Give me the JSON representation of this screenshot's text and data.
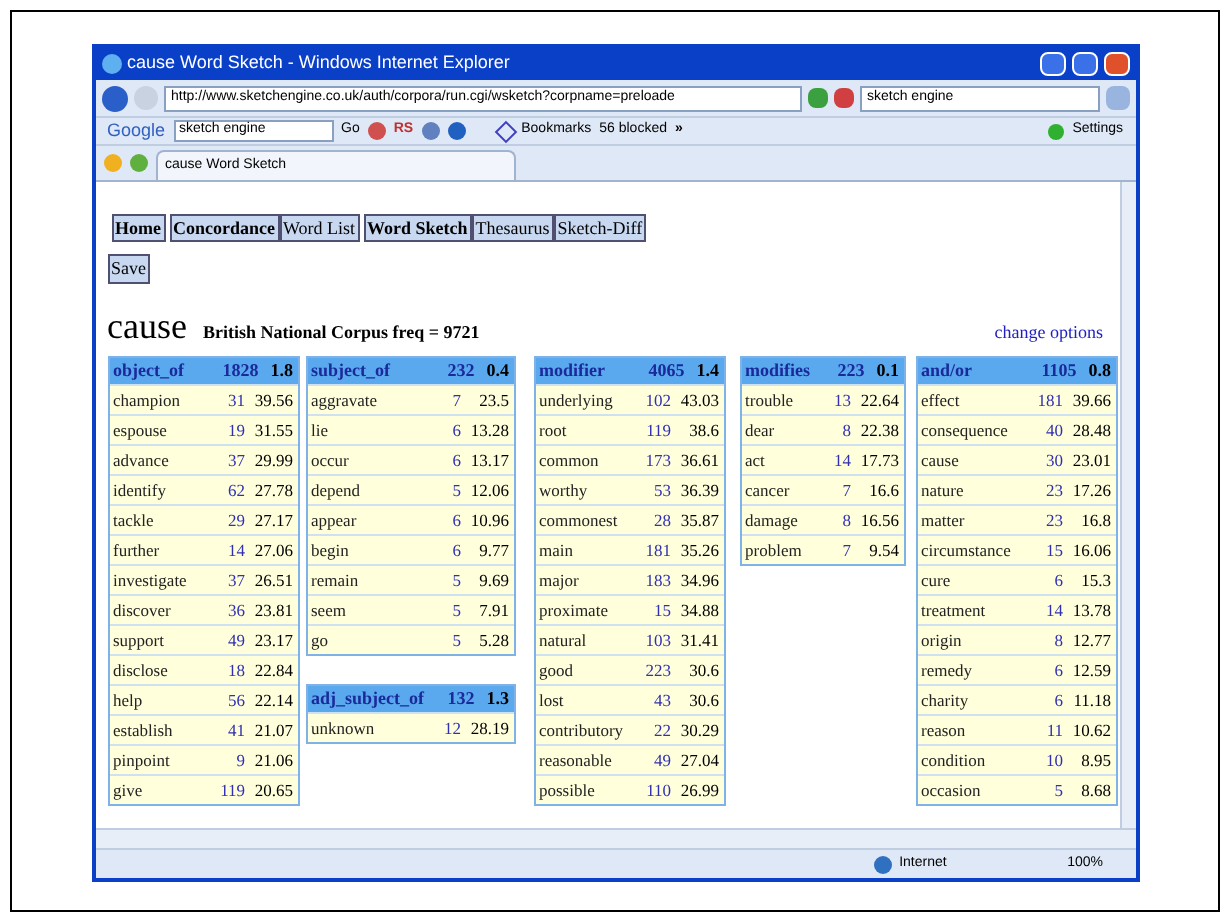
{
  "window": {
    "title": "cause Word Sketch - Windows Internet Explorer"
  },
  "address_bar": {
    "url": "http://www.sketchengine.co.uk/auth/corpora/run.cgi/wsketch?corpname=preloade",
    "search": "sketch engine"
  },
  "google_toolbar": {
    "logo": "Google",
    "search": "sketch engine",
    "go": "Go",
    "rs": "RS",
    "bookmarks": "Bookmarks",
    "blocked": "56 blocked",
    "more": "»",
    "settings": "Settings"
  },
  "tab": {
    "title": "cause Word Sketch"
  },
  "nav": [
    {
      "label": "Home",
      "bold": true
    },
    {
      "label": "Concordance",
      "bold": true
    },
    {
      "label": "Word List",
      "bold": false
    },
    {
      "label": "Word Sketch",
      "bold": true
    },
    {
      "label": "Thesaurus",
      "bold": false
    },
    {
      "label": "Sketch-Diff",
      "bold": false
    }
  ],
  "save": "Save",
  "headword": "cause",
  "corpus_info": "British National Corpus freq = 9721",
  "change_options": "change options",
  "columns": [
    [
      {
        "heading": "object_of",
        "count": "1828",
        "score": "1.8",
        "rows": [
          {
            "word": "champion",
            "freq": "31",
            "score": "39.56"
          },
          {
            "word": "espouse",
            "freq": "19",
            "score": "31.55"
          },
          {
            "word": "advance",
            "freq": "37",
            "score": "29.99"
          },
          {
            "word": "identify",
            "freq": "62",
            "score": "27.78"
          },
          {
            "word": "tackle",
            "freq": "29",
            "score": "27.17"
          },
          {
            "word": "further",
            "freq": "14",
            "score": "27.06"
          },
          {
            "word": "investigate",
            "freq": "37",
            "score": "26.51"
          },
          {
            "word": "discover",
            "freq": "36",
            "score": "23.81"
          },
          {
            "word": "support",
            "freq": "49",
            "score": "23.17"
          },
          {
            "word": "disclose",
            "freq": "18",
            "score": "22.84"
          },
          {
            "word": "help",
            "freq": "56",
            "score": "22.14"
          },
          {
            "word": "establish",
            "freq": "41",
            "score": "21.07"
          },
          {
            "word": "pinpoint",
            "freq": "9",
            "score": "21.06"
          },
          {
            "word": "give",
            "freq": "119",
            "score": "20.65"
          }
        ]
      }
    ],
    [
      {
        "heading": "subject_of",
        "count": "232",
        "score": "0.4",
        "rows": [
          {
            "word": "aggravate",
            "freq": "7",
            "score": "23.5"
          },
          {
            "word": "lie",
            "freq": "6",
            "score": "13.28"
          },
          {
            "word": "occur",
            "freq": "6",
            "score": "13.17"
          },
          {
            "word": "depend",
            "freq": "5",
            "score": "12.06"
          },
          {
            "word": "appear",
            "freq": "6",
            "score": "10.96"
          },
          {
            "word": "begin",
            "freq": "6",
            "score": "9.77"
          },
          {
            "word": "remain",
            "freq": "5",
            "score": "9.69"
          },
          {
            "word": "seem",
            "freq": "5",
            "score": "7.91"
          },
          {
            "word": "go",
            "freq": "5",
            "score": "5.28"
          }
        ]
      },
      {
        "heading": "adj_subject_of",
        "count": "132",
        "score": "1.3",
        "rows": [
          {
            "word": "unknown",
            "freq": "12",
            "score": "28.19"
          }
        ]
      }
    ],
    [
      {
        "heading": "modifier",
        "count": "4065",
        "score": "1.4",
        "rows": [
          {
            "word": "underlying",
            "freq": "102",
            "score": "43.03"
          },
          {
            "word": "root",
            "freq": "119",
            "score": "38.6"
          },
          {
            "word": "common",
            "freq": "173",
            "score": "36.61"
          },
          {
            "word": "worthy",
            "freq": "53",
            "score": "36.39"
          },
          {
            "word": "commonest",
            "freq": "28",
            "score": "35.87"
          },
          {
            "word": "main",
            "freq": "181",
            "score": "35.26"
          },
          {
            "word": "major",
            "freq": "183",
            "score": "34.96"
          },
          {
            "word": "proximate",
            "freq": "15",
            "score": "34.88"
          },
          {
            "word": "natural",
            "freq": "103",
            "score": "31.41"
          },
          {
            "word": "good",
            "freq": "223",
            "score": "30.6"
          },
          {
            "word": "lost",
            "freq": "43",
            "score": "30.6"
          },
          {
            "word": "contributory",
            "freq": "22",
            "score": "30.29"
          },
          {
            "word": "reasonable",
            "freq": "49",
            "score": "27.04"
          },
          {
            "word": "possible",
            "freq": "110",
            "score": "26.99"
          }
        ]
      }
    ],
    [
      {
        "heading": "modifies",
        "count": "223",
        "score": "0.1",
        "rows": [
          {
            "word": "trouble",
            "freq": "13",
            "score": "22.64"
          },
          {
            "word": "dear",
            "freq": "8",
            "score": "22.38"
          },
          {
            "word": "act",
            "freq": "14",
            "score": "17.73"
          },
          {
            "word": "cancer",
            "freq": "7",
            "score": "16.6"
          },
          {
            "word": "damage",
            "freq": "8",
            "score": "16.56"
          },
          {
            "word": "problem",
            "freq": "7",
            "score": "9.54"
          }
        ]
      }
    ],
    [
      {
        "heading": "and/or",
        "count": "1105",
        "score": "0.8",
        "rows": [
          {
            "word": "effect",
            "freq": "181",
            "score": "39.66"
          },
          {
            "word": "consequence",
            "freq": "40",
            "score": "28.48"
          },
          {
            "word": "cause",
            "freq": "30",
            "score": "23.01"
          },
          {
            "word": "nature",
            "freq": "23",
            "score": "17.26"
          },
          {
            "word": "matter",
            "freq": "23",
            "score": "16.8"
          },
          {
            "word": "circumstance",
            "freq": "15",
            "score": "16.06"
          },
          {
            "word": "cure",
            "freq": "6",
            "score": "15.3"
          },
          {
            "word": "treatment",
            "freq": "14",
            "score": "13.78"
          },
          {
            "word": "origin",
            "freq": "8",
            "score": "12.77"
          },
          {
            "word": "remedy",
            "freq": "6",
            "score": "12.59"
          },
          {
            "word": "charity",
            "freq": "6",
            "score": "11.18"
          },
          {
            "word": "reason",
            "freq": "11",
            "score": "10.62"
          },
          {
            "word": "condition",
            "freq": "10",
            "score": "8.95"
          },
          {
            "word": "occasion",
            "freq": "5",
            "score": "8.68"
          }
        ]
      }
    ]
  ],
  "status_bar": {
    "zone": "Internet",
    "zoom": "100%"
  }
}
